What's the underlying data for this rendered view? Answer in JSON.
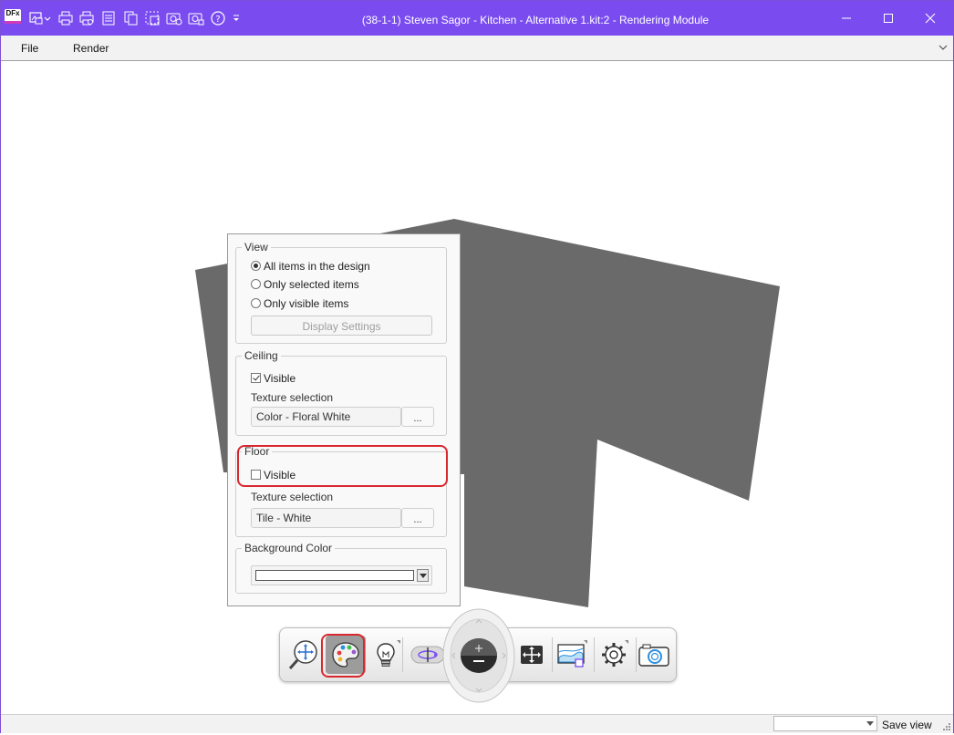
{
  "titlebar": {
    "logo_text": "DFx",
    "title": "(38-1-1) Steven Sagor - Kitchen - Alternative 1.kit:2 - Rendering Module",
    "quick_access_icons": [
      "image-export-icon",
      "print-icon",
      "print-preview-icon",
      "page-setup-icon",
      "copy-icon",
      "select-area-icon",
      "camera-settings-icon",
      "render-settings-icon",
      "help-icon",
      "customize-icon"
    ],
    "buttons": [
      "minimize-icon",
      "maximize-icon",
      "close-icon"
    ]
  },
  "menu": {
    "items": [
      "File",
      "Render"
    ]
  },
  "panel": {
    "view": {
      "title": "View",
      "options": [
        "All items in the design",
        "Only selected items",
        "Only visible items"
      ],
      "selected": 0,
      "display_settings_label": "Display Settings"
    },
    "ceiling": {
      "title": "Ceiling",
      "visible_label": "Visible",
      "visible": true,
      "texture_label": "Texture selection",
      "texture_value": "Color - Floral White",
      "browse_label": "..."
    },
    "floor": {
      "title": "Floor",
      "visible_label": "Visible",
      "visible": false,
      "texture_label": "Texture selection",
      "texture_value": "Tile - White",
      "browse_label": "..."
    },
    "background": {
      "title": "Background Color",
      "color": "#ffffff"
    }
  },
  "render_toolbar": {
    "buttons": [
      "zoom-navigate-icon",
      "palette-icon",
      "lighting-icon",
      "orbit-icon",
      "zoom-dial",
      "fit-view-icon",
      "background-image-icon",
      "settings-gear-icon",
      "camera-icon"
    ],
    "active": "palette-icon"
  },
  "statusbar": {
    "view_combo_value": "",
    "save_view_label": "Save view"
  },
  "colors": {
    "titlebar": "#7a4cf0",
    "walls": "#6a6a6a",
    "highlight": "#d9272e"
  }
}
